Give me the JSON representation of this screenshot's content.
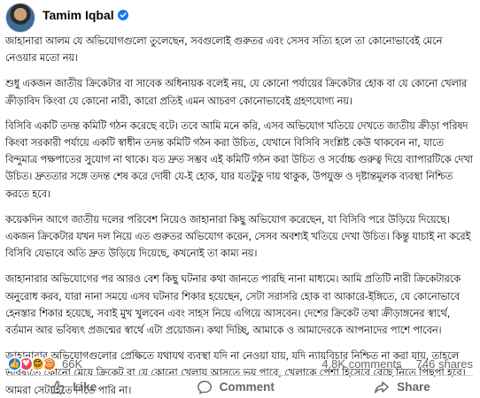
{
  "post": {
    "author": "Tamim Iqbal",
    "paragraphs": [
      "জাহানারা আলম যে অভিযোগগুলো তুলেছেন, সবগুলোই গুরুতর এবং সেসব সত্যি হলে তা কোনোভাবেই মেনে নেওয়ার মতো নয়।",
      "শুধু একজন জাতীয় ক্রিকেটার বা সাবেক অধিনায়ক বলেই নয়, যে কোনো পর্যায়ের ক্রিকেটার হোক বা যে কোনো খেলার ক্রীড়াবিদ কিংবা যে কোনো নারী, কারো প্রতিই এমন আচরণ কোনোভাবেই গ্রহণযোগ্য নয়।",
      "বিসিবি একটি তদন্ত কমিটি গঠন করেছে বটে। তবে আমি মনে করি, এসব অভিযোগ খতিয়ে দেখতে জাতীয় ক্রীড়া পরিষদ কিংবা সরকারী পর্যায়ে একটি স্বাধীন তদন্ত কমিটি গঠন করা উচিত, যেখানে বিসিবি সংশ্লিষ্ট কেউ থাকবেন না, যাতে বিন্দুমাত্র পক্ষপাতের সুযোগ না থাকে। যত দ্রুত সম্ভব এই কমিটি গঠন করা উচিত ও সর্বোচ্চ গুরুত্ব দিয়ে ব্যাপারটিকে দেখা উচিত। দ্রুততার সঙ্গে তদন্ত শেষ করে দোষী যে-ই হোক, যার যতটুকু দায় থাকুক, উপযুক্ত ও দৃষ্টান্তমূলক ব্যবস্থা নিশ্চিত করতে হবে।",
      "কয়েকদিন আগে জাতীয় দলের পরিবেশ নিয়েও জাহানারা কিছু অভিযোগ করেছেন, যা বিসিবি পরে উড়িয়ে দিয়েছে। একজন ক্রিকেটার যখন দল নিয়ে এত গুরুতর অভিযোগ করেন, সেসব অবশ্যই খতিয়ে দেখা উচিত। কিন্তু যাচাই না করেই বিসিবি যেভাবে অতি দ্রুত উড়িয়ে দিয়েছে, কখনোই তা কাম্য নয়।",
      "জাহানারার অভিযোগের পর আরও বেশ কিছু ঘটনার কথা জানতে পারছি নানা মাধ্যমে। আমি প্রতিটি নারী ক্রিকেটারকে অনুরোধ করব, যারা নানা সময়ে এসব ঘটনার শিকার হয়েছেন, সেটা সরাসরি হোক বা আকারে-ইঙ্গিতে, যে কোনোভাবে হেনস্তার শিকার হয়েছে, সবাই মুখ খুলবেন এবং সাহস নিয়ে এগিয়ে আসবেন। দেশের ক্রিকেট তথা ক্রীড়াঙ্গনের স্বার্থে, বর্তমান আর ভবিষ্যৎ প্রজন্মের স্বার্থে এটা প্রয়োজন। কথা দিচ্ছি, আমাকে ও আমাদেরকে আপনাদের পাশে পাবেন।",
      "জাহানারার অভিযোগগুলোর প্রেক্ষিতে যথাযথ ব্যবস্থা যদি না নেওয়া যায়, যদি ন্যায়বিচার নিশ্চিত না করা যায়, তাহলে ভবিষ্যতে কোনো মেয়ে ক্রিকেট বা যে কোনো খেলায় আসতে ভয় পাবে, খেলাকে পেশা হিসেবে বেছে নিতে পিছপা হবে। আমরা সেটা হতে দিতে পারি না।"
    ]
  },
  "stats": {
    "reaction_count": "66K",
    "comments": "4.8K comments",
    "shares": "746 shares"
  },
  "actions": {
    "like": "Like",
    "comment": "Comment",
    "share": "Share"
  },
  "colors": {
    "facebook_blue": "#1877f2",
    "muted_text": "#65676b"
  }
}
